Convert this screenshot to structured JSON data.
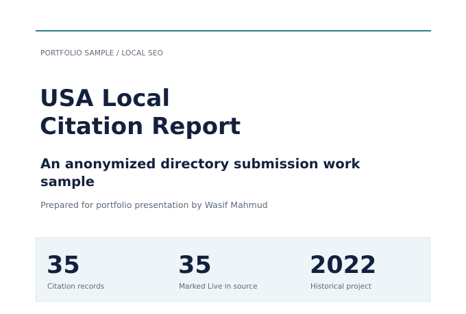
{
  "header": {
    "eyebrow": "PORTFOLIO SAMPLE / LOCAL SEO"
  },
  "report": {
    "title": "USA Local\nCitation Report",
    "subtitle": "An anonymized directory submission work sample",
    "prepared_by": "Prepared for portfolio presentation by Wasif Mahmud"
  },
  "stats": [
    {
      "value": "35",
      "label": "Citation records"
    },
    {
      "value": "35",
      "label": "Marked Live in source"
    },
    {
      "value": "2022",
      "label": "Historical project"
    }
  ],
  "colors": {
    "accent": "#2a7b8c",
    "heading": "#13213d",
    "muted": "#5d6b7a",
    "panel_bg": "#eef5f8"
  }
}
